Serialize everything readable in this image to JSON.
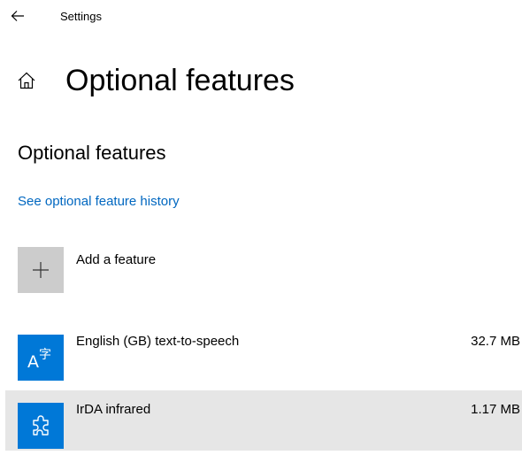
{
  "header": {
    "back_icon": "back-arrow-icon",
    "app_title": "Settings"
  },
  "page": {
    "home_icon": "home-icon",
    "title": "Optional features"
  },
  "section": {
    "title": "Optional features",
    "history_link": "See optional feature history"
  },
  "add_feature": {
    "icon": "plus-icon",
    "label": "Add a feature"
  },
  "features": [
    {
      "icon": "text-to-speech-icon",
      "name": "English (GB) text-to-speech",
      "size": "32.7 MB",
      "selected": false
    },
    {
      "icon": "puzzle-piece-icon",
      "name": "IrDA infrared",
      "size": "1.17 MB",
      "selected": true
    }
  ],
  "colors": {
    "accent": "#0078d7",
    "link": "#0067c0",
    "tile_gray": "#cccccc",
    "selected_row": "#e6e6e6"
  }
}
